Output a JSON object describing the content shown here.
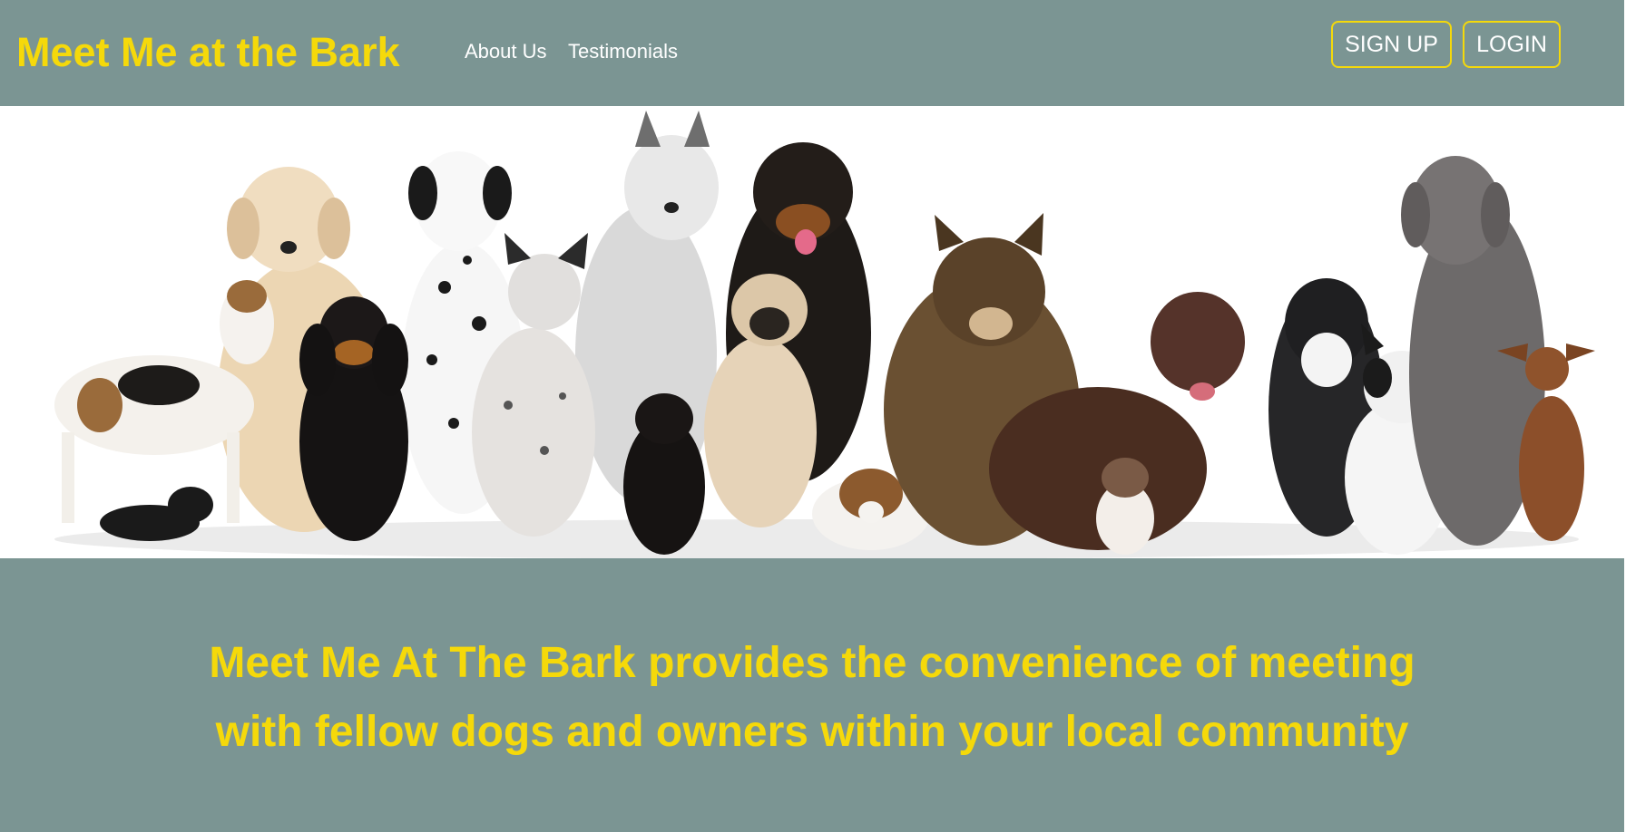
{
  "header": {
    "brand": "Meet Me at the Bark",
    "links": [
      {
        "label": "About Us"
      },
      {
        "label": "Testimonials"
      }
    ],
    "buttons": {
      "signup": "SIGN UP",
      "login": "LOGIN"
    }
  },
  "hero": {
    "image_icon": "dog-group-photo"
  },
  "intro": {
    "headline": "Meet Me At The Bark provides the convenience of meeting with fellow dogs and owners within your local community"
  },
  "colors": {
    "nav_bg": "#7b9593",
    "accent": "#f5d90a",
    "text_light": "#ffffff"
  }
}
